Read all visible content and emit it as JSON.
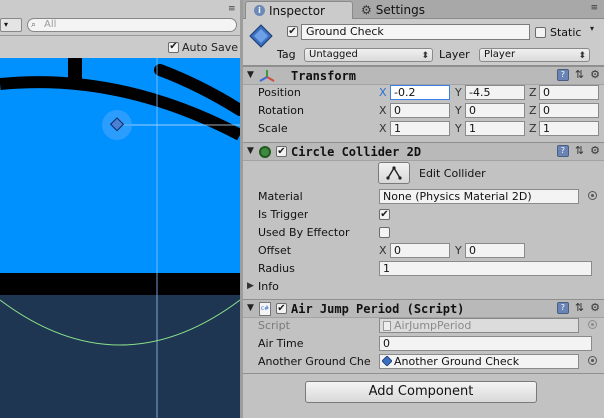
{
  "scene": {
    "search_placeholder": "All",
    "search_icon": "search-icon",
    "dropdown_glyph": "▾",
    "menu_glyph": "≡",
    "maximize_on_play": {
      "label": "Auto Save",
      "checked": true
    }
  },
  "inspector": {
    "tabs": [
      {
        "label": "Inspector",
        "icon": "info-icon",
        "active": true
      },
      {
        "label": "Settings",
        "icon": "gear-icon",
        "active": false
      }
    ],
    "menu_glyph": "≡",
    "gameobject": {
      "icon": "gameobject-cube-icon",
      "active": true,
      "name": "Ground Check",
      "static_label": "Static",
      "static_checked": false,
      "tag_label": "Tag",
      "tag_value": "Untagged",
      "layer_label": "Layer",
      "layer_value": "Player"
    },
    "transform": {
      "title": "Transform",
      "rows": [
        {
          "label": "Position",
          "x": "-0.2",
          "y": "-4.5",
          "z": "0"
        },
        {
          "label": "Rotation",
          "x": "0",
          "y": "0",
          "z": "0"
        },
        {
          "label": "Scale",
          "x": "1",
          "y": "1",
          "z": "1"
        }
      ]
    },
    "circle_collider": {
      "title": "Circle Collider 2D",
      "enabled": true,
      "edit_label": "Edit Collider",
      "material_label": "Material",
      "material_value": "None (Physics Material 2D)",
      "is_trigger_label": "Is Trigger",
      "is_trigger": true,
      "used_by_effector_label": "Used By Effector",
      "used_by_effector": false,
      "offset_label": "Offset",
      "offset_x": "0",
      "offset_y": "0",
      "radius_label": "Radius",
      "radius_value": "1",
      "info_label": "Info"
    },
    "script_comp": {
      "title": "Air Jump Period (Script)",
      "enabled": true,
      "script_label": "Script",
      "script_value": "AirJumpPeriod",
      "air_time_label": "Air Time",
      "air_time_value": "0",
      "another_label": "Another Ground Che",
      "another_value": "Another Ground Check"
    },
    "axis_labels": {
      "x": "X",
      "y": "Y",
      "z": "Z"
    },
    "add_component_label": "Add Component"
  },
  "colors": {
    "scene_blue": "#0091ff",
    "scene_dark": "#1e3652",
    "selection_blue": "#3a7ee8",
    "collider_green": "#8be08b"
  }
}
